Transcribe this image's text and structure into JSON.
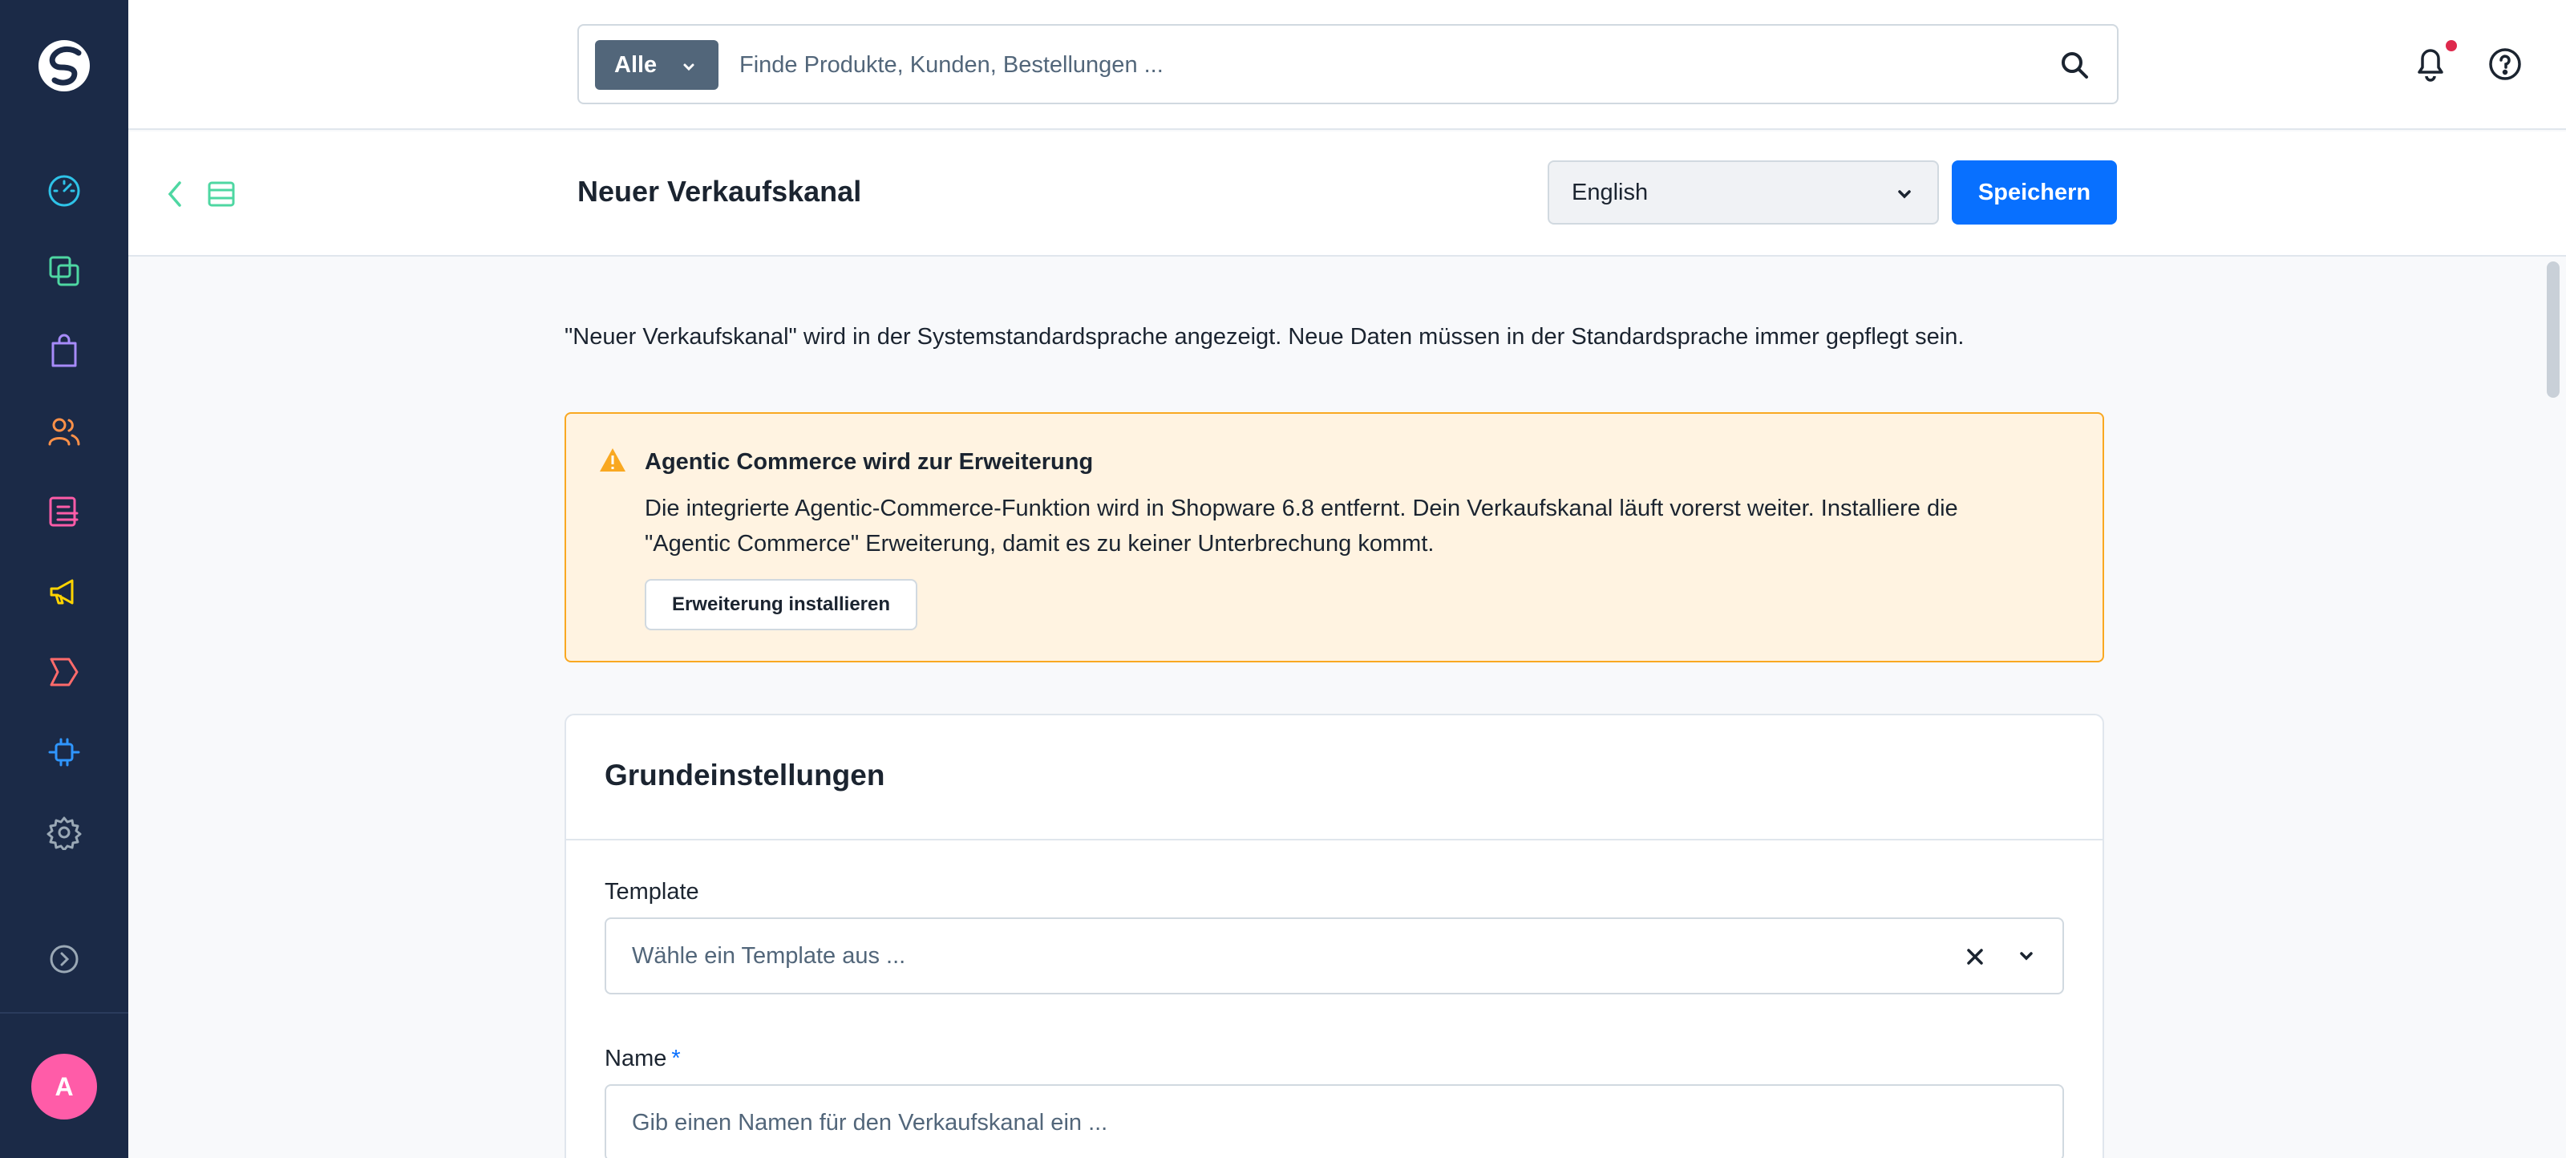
{
  "sidebar": {
    "items": [
      {
        "icon": "dashboard-gauge-icon",
        "color": "#2ec3e8"
      },
      {
        "icon": "catalog-copy-icon",
        "color": "#4ed7a2"
      },
      {
        "icon": "orders-bag-icon",
        "color": "#a78bfa"
      },
      {
        "icon": "customers-users-icon",
        "color": "#ff9148"
      },
      {
        "icon": "content-layout-icon",
        "color": "#ff5ca8"
      },
      {
        "icon": "marketing-megaphone-icon",
        "color": "#ffd400"
      },
      {
        "icon": "promotions-tag-icon",
        "color": "#ff6b6b"
      },
      {
        "icon": "extensions-plug-icon",
        "color": "#2f96ff"
      },
      {
        "icon": "settings-gear-icon",
        "color": "#9aa8b5"
      }
    ],
    "collapse_icon": "chevron-right-circle-icon",
    "avatar_initial": "A",
    "avatar_color": "#ff5ca8"
  },
  "search": {
    "type_label": "Alle",
    "placeholder": "Finde Produkte, Kunden, Bestellungen ..."
  },
  "header": {
    "title": "Neuer Verkaufskanal",
    "language": "English",
    "save_label": "Speichern",
    "accent_color": "#0870ff"
  },
  "notice": "\"Neuer Verkaufskanal\" wird in der Systemstandardsprache angezeigt. Neue Daten müssen in der Standardsprache immer gepflegt sein.",
  "alert": {
    "title": "Agentic Commerce wird zur Erweiterung",
    "text_line1": "Die integrierte Agentic-Commerce-Funktion wird in Shopware 6.8 entfernt. Dein Verkaufskanal läuft vorerst weiter. Installiere die",
    "text_line2": "\"Agentic Commerce\" Erweiterung, damit es zu keiner Unterbrechung kommt.",
    "button_label": "Erweiterung installieren",
    "color": "#f9a821"
  },
  "card": {
    "title": "Grundeinstellungen",
    "template_label": "Template",
    "template_placeholder": "Wähle ein Template aus ...",
    "name_label": "Name",
    "name_required": "*",
    "name_placeholder": "Gib einen Namen für den Verkaufskanal ein ..."
  }
}
